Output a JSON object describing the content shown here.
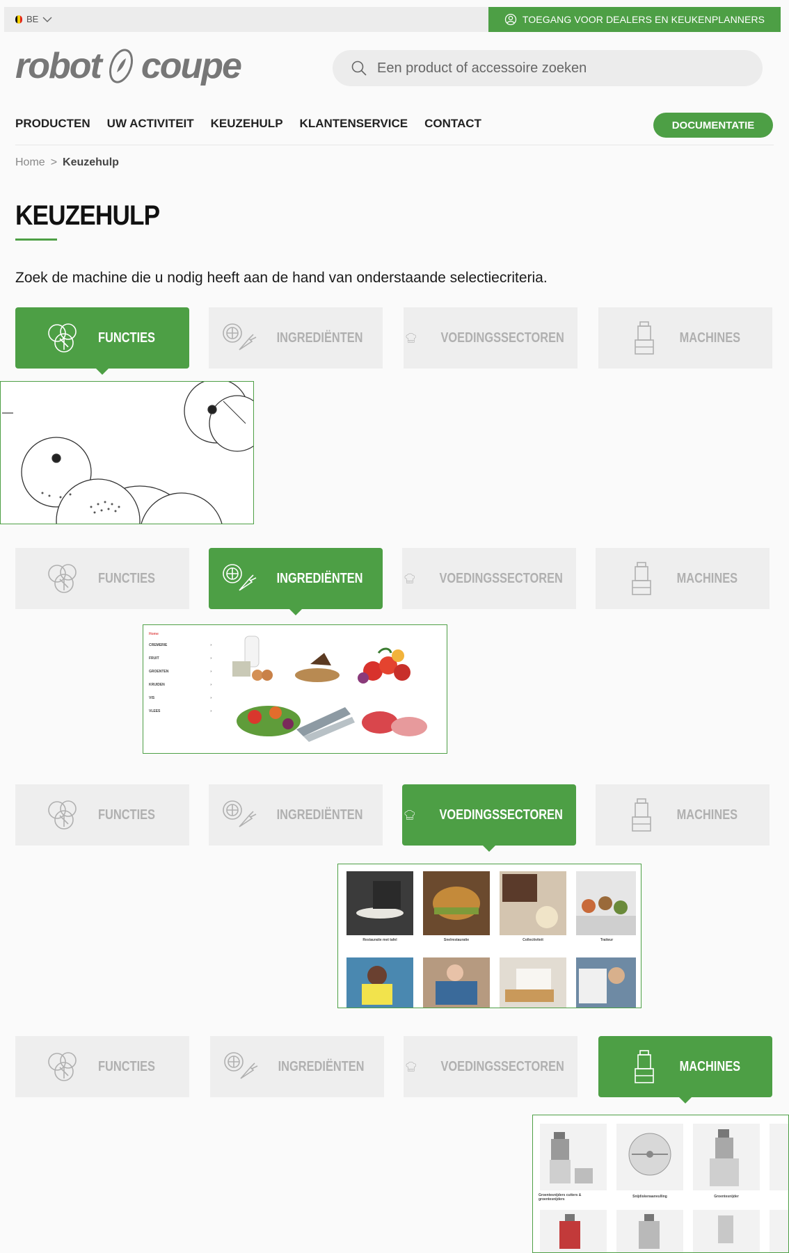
{
  "topbar": {
    "lang": "BE",
    "dealer_link": "TOEGANG VOOR DEALERS EN KEUKENPLANNERS",
    "flag_colors": [
      "#111111",
      "#f5d000",
      "#e2231a"
    ]
  },
  "header": {
    "logo_left": "robot",
    "logo_right": "coupe",
    "search_placeholder": "Een product of accessoire zoeken"
  },
  "nav": {
    "items": [
      "PRODUCTEN",
      "UW ACTIVITEIT",
      "KEUZEHULP",
      "KLANTENSERVICE",
      "CONTACT"
    ],
    "doc_button": "DOCUMENTATIE"
  },
  "breadcrumb": {
    "home": "Home",
    "sep": ">",
    "current": "Keuzehulp"
  },
  "page": {
    "title": "KEUZEHULP",
    "intro": "Zoek de machine die u nodig heeft aan de hand van onderstaande selectiecriteria."
  },
  "tabs": [
    "FUNCTIES",
    "INGREDIËNTEN",
    "VOEDINGSSECTOREN",
    "MACHINES"
  ],
  "ingredients_panel": {
    "heading": "Home",
    "categories": [
      "CREMERIE",
      "FRUIT",
      "GROENTEN",
      "KRUIDEN",
      "VIS",
      "VLEES"
    ]
  },
  "sectors_panel": {
    "captions": [
      "Restauratie met tafel",
      "Snelrestauratie",
      "Collectiviteit",
      "Traiteur"
    ]
  },
  "machines_panel": {
    "captions": [
      "Groentesnijders cutters & groentesnijders",
      "Snijdiskenaanvulling",
      "Groentesnijder"
    ]
  },
  "colors": {
    "accent": "#4d9f45",
    "tab_inactive": "#eeeeee"
  }
}
